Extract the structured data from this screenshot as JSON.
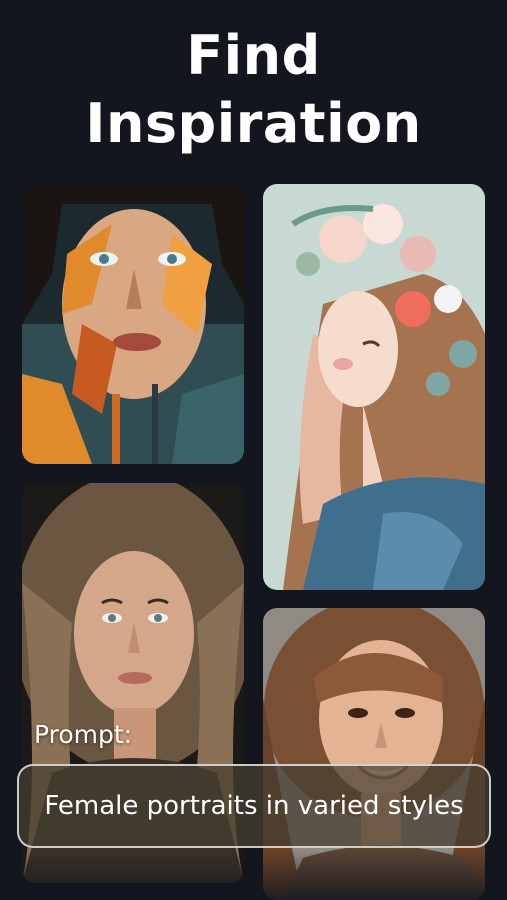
{
  "header": {
    "title_line1": "Find",
    "title_line2": "Inspiration"
  },
  "gallery": {
    "images": [
      {
        "name": "abstract-painted-portrait"
      },
      {
        "name": "anime-girl-flower-crown"
      },
      {
        "name": "wavy-hair-portrait"
      },
      {
        "name": "bangs-smiling-portrait"
      }
    ]
  },
  "prompt": {
    "label": "Prompt:",
    "text": "Female portraits in varied styles"
  },
  "colors": {
    "background": "#13161f",
    "prompt_box": "#463e30"
  }
}
